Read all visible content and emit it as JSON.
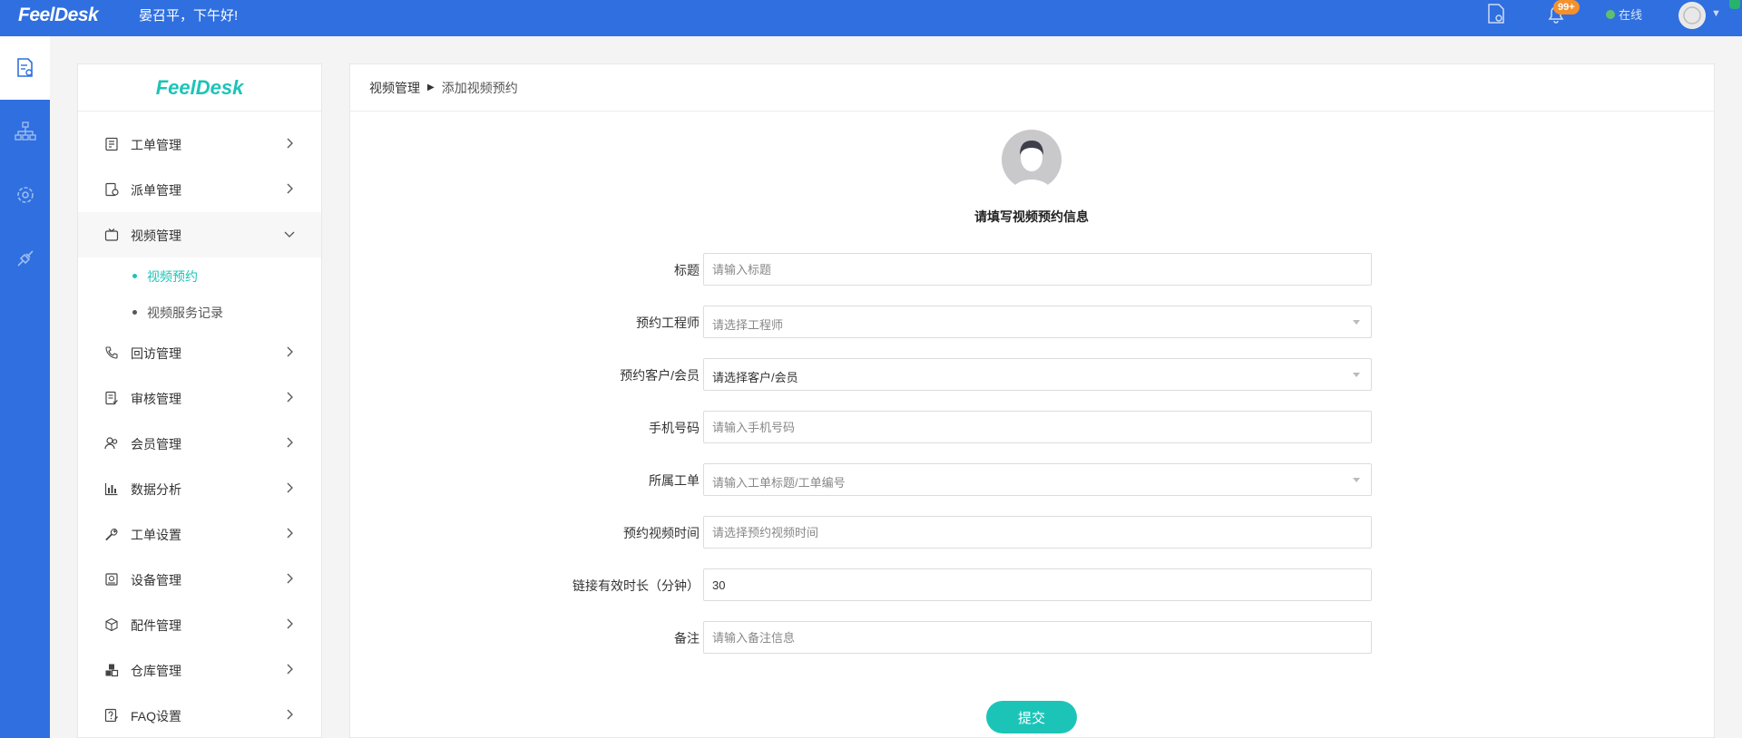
{
  "topbar": {
    "logo": "FeelDesk",
    "greeting": "晏召平，下午好!",
    "badge": "99+",
    "status": "在线"
  },
  "rail": {
    "items": [
      {
        "icon": "settings-doc-icon"
      },
      {
        "icon": "org-chart-icon"
      },
      {
        "icon": "gear-icon"
      },
      {
        "icon": "plug-icon"
      }
    ]
  },
  "menu": {
    "logo": "FeelDesk",
    "items": [
      {
        "label": "工单管理",
        "icon": "ticket-icon"
      },
      {
        "label": "派单管理",
        "icon": "dispatch-icon"
      },
      {
        "label": "视频管理",
        "icon": "tv-icon"
      },
      {
        "label": "回访管理",
        "icon": "phone-icon"
      },
      {
        "label": "审核管理",
        "icon": "audit-icon"
      },
      {
        "label": "会员管理",
        "icon": "members-icon"
      },
      {
        "label": "数据分析",
        "icon": "chart-icon"
      },
      {
        "label": "工单设置",
        "icon": "wrench-icon"
      },
      {
        "label": "设备管理",
        "icon": "device-icon"
      },
      {
        "label": "配件管理",
        "icon": "box-icon"
      },
      {
        "label": "仓库管理",
        "icon": "warehouse-icon"
      },
      {
        "label": "FAQ设置",
        "icon": "faq-icon"
      }
    ],
    "sub_items": [
      {
        "label": "视频预约"
      },
      {
        "label": "视频服务记录"
      }
    ]
  },
  "breadcrumb": {
    "parent": "视频管理",
    "current": "添加视频预约"
  },
  "form": {
    "title": "请填写视频预约信息",
    "fields": [
      {
        "label": "标题",
        "type": "input",
        "placeholder": "请输入标题",
        "value": ""
      },
      {
        "label": "预约工程师",
        "type": "select",
        "text": "请选择工程师"
      },
      {
        "label": "预约客户/会员",
        "type": "select",
        "text": "请选择客户/会员"
      },
      {
        "label": "手机号码",
        "type": "input",
        "placeholder": "请输入手机号码",
        "value": ""
      },
      {
        "label": "所属工单",
        "type": "select",
        "text": "请输入工单标题/工单编号"
      },
      {
        "label": "预约视频时间",
        "type": "input",
        "placeholder": "请选择预约视频时间",
        "value": ""
      },
      {
        "label": "链接有效时长（分钟）",
        "type": "input",
        "placeholder": "",
        "value": "30"
      },
      {
        "label": "备注",
        "type": "input",
        "placeholder": "请输入备注信息",
        "value": ""
      }
    ],
    "submit": "提交"
  },
  "colors": {
    "brand_blue": "#2f6fe0",
    "accent_teal": "#1cc4b8",
    "badge_orange": "#f7902a",
    "online_green": "#5ec06a"
  }
}
